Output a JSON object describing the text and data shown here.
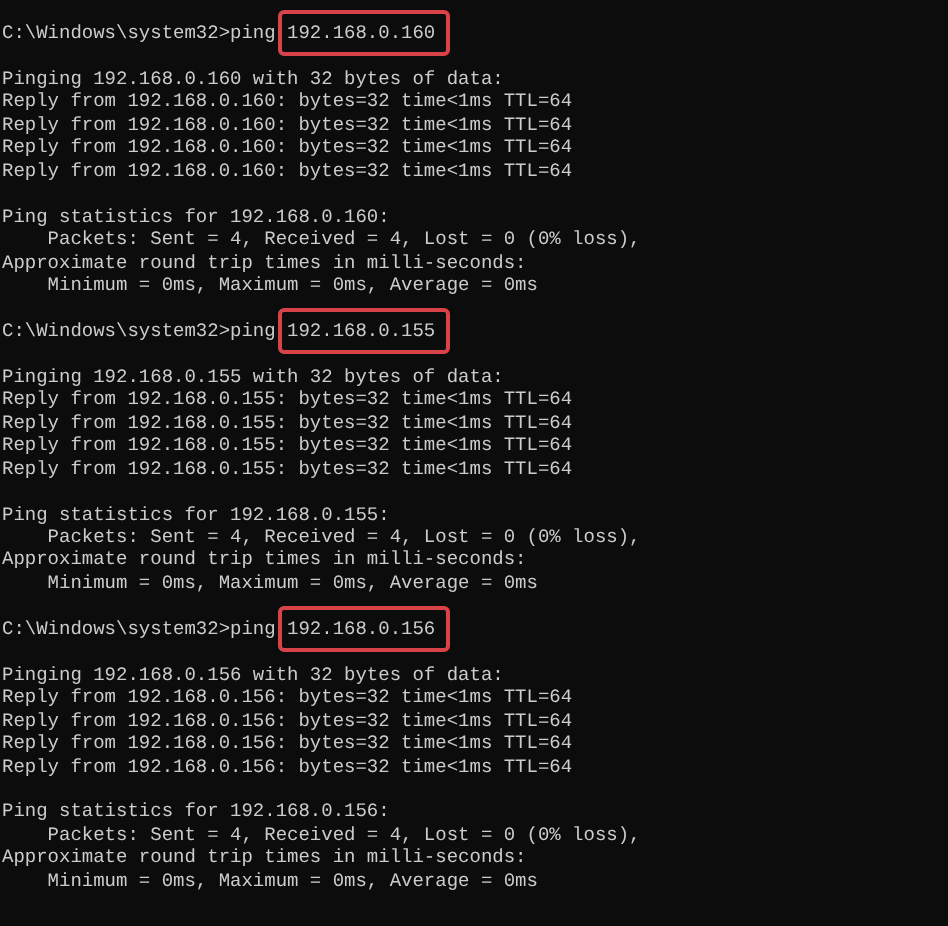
{
  "console": {
    "blocks": [
      {
        "command": {
          "prompt": "C:\\Windows\\system32>ping",
          "argument": "192.168.0.160",
          "highlighted": true
        },
        "groups": [
          {
            "lines": [
              "Pinging 192.168.0.160 with 32 bytes of data:",
              "Reply from 192.168.0.160: bytes=32 time<1ms TTL=64",
              "Reply from 192.168.0.160: bytes=32 time<1ms TTL=64",
              "Reply from 192.168.0.160: bytes=32 time<1ms TTL=64",
              "Reply from 192.168.0.160: bytes=32 time<1ms TTL=64"
            ]
          },
          {
            "lines": [
              "Ping statistics for 192.168.0.160:",
              "    Packets: Sent = 4, Received = 4, Lost = 0 (0% loss),",
              "Approximate round trip times in milli-seconds:",
              "    Minimum = 0ms, Maximum = 0ms, Average = 0ms"
            ]
          }
        ]
      },
      {
        "command": {
          "prompt": "C:\\Windows\\system32>ping",
          "argument": "192.168.0.155",
          "highlighted": true
        },
        "groups": [
          {
            "lines": [
              "Pinging 192.168.0.155 with 32 bytes of data:",
              "Reply from 192.168.0.155: bytes=32 time<1ms TTL=64",
              "Reply from 192.168.0.155: bytes=32 time<1ms TTL=64",
              "Reply from 192.168.0.155: bytes=32 time<1ms TTL=64",
              "Reply from 192.168.0.155: bytes=32 time<1ms TTL=64"
            ]
          },
          {
            "lines": [
              "Ping statistics for 192.168.0.155:",
              "    Packets: Sent = 4, Received = 4, Lost = 0 (0% loss),",
              "Approximate round trip times in milli-seconds:",
              "    Minimum = 0ms, Maximum = 0ms, Average = 0ms"
            ]
          }
        ]
      },
      {
        "command": {
          "prompt": "C:\\Windows\\system32>ping",
          "argument": "192.168.0.156",
          "highlighted": true
        },
        "groups": [
          {
            "lines": [
              "Pinging 192.168.0.156 with 32 bytes of data:",
              "Reply from 192.168.0.156: bytes=32 time<1ms TTL=64",
              "Reply from 192.168.0.156: bytes=32 time<1ms TTL=64",
              "Reply from 192.168.0.156: bytes=32 time<1ms TTL=64",
              "Reply from 192.168.0.156: bytes=32 time<1ms TTL=64"
            ]
          },
          {
            "lines": [
              "Ping statistics for 192.168.0.156:",
              "    Packets: Sent = 4, Received = 4, Lost = 0 (0% loss),",
              "Approximate round trip times in milli-seconds:",
              "    Minimum = 0ms, Maximum = 0ms, Average = 0ms"
            ]
          }
        ]
      }
    ]
  }
}
